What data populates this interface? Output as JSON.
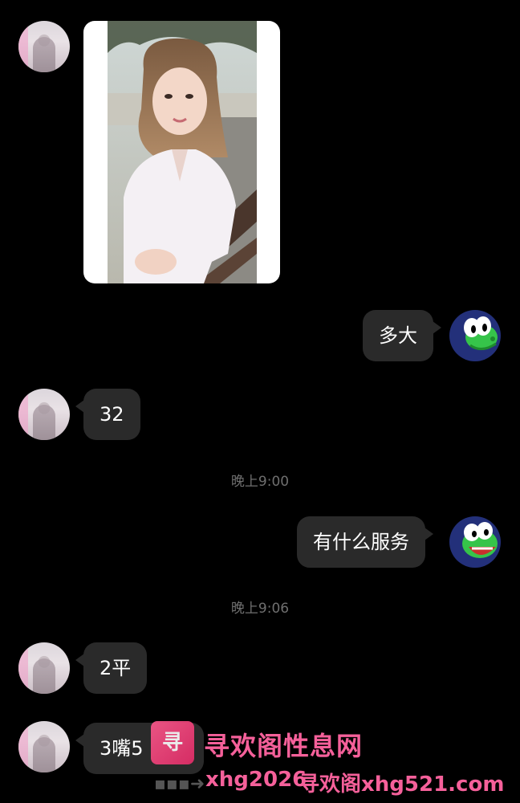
{
  "messages": [
    {
      "id": "m1",
      "side": "left",
      "type": "image"
    },
    {
      "id": "m2",
      "side": "right",
      "text": "多大"
    },
    {
      "id": "m3",
      "side": "left",
      "text": "32"
    },
    {
      "id": "m4",
      "side": "right",
      "text": "有什么服务"
    },
    {
      "id": "m5",
      "side": "left",
      "text": "2平"
    },
    {
      "id": "m6",
      "side": "left",
      "text": "3嘴5"
    }
  ],
  "timestamps": [
    "晚上9:00",
    "晚上9:06"
  ],
  "watermark": {
    "logo": "寻",
    "title": "寻欢阁性息网",
    "url_left": "xhg2026",
    "url_right": "寻欢阁xhg521.com"
  },
  "colors": {
    "background": "#000000",
    "bubble": "#2a2a2a",
    "timestamp": "#6f6f6f",
    "watermark": "#f5609a",
    "yoshi_avatar_bg": "#23307a"
  },
  "icons": {
    "contact_avatar": "girl-photo-avatar",
    "self_avatar": "yoshi-avatar"
  }
}
